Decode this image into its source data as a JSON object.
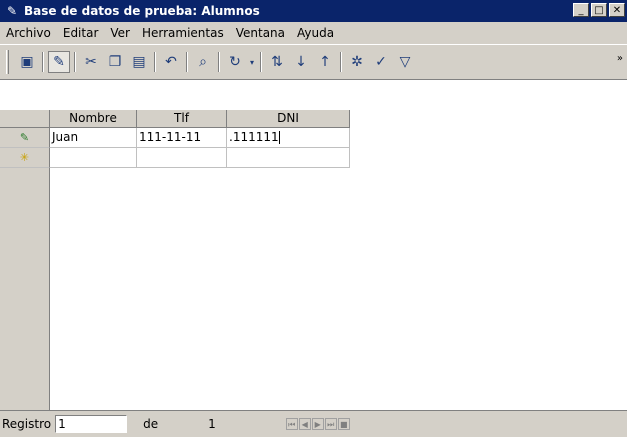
{
  "window": {
    "title": "Base de datos de prueba: Alumnos"
  },
  "menu": [
    "Archivo",
    "Editar",
    "Ver",
    "Herramientas",
    "Ventana",
    "Ayuda"
  ],
  "toolbar": {
    "icons": [
      "save-icon",
      "edit-icon",
      "cut-icon",
      "copy-icon",
      "paste-icon",
      "undo-icon",
      "find-icon",
      "refresh-icon",
      "sort-icon",
      "sort-ascending-icon",
      "sort-descending-icon",
      "filter-auto-icon",
      "filter-apply-icon",
      "filter-icon"
    ]
  },
  "table": {
    "columns": [
      "Nombre",
      "Tlf",
      "DNI"
    ],
    "rows": [
      {
        "nombre": "Juan",
        "tlf": "111-11-11",
        "dni": ".111111"
      },
      {
        "nombre": "",
        "tlf": "",
        "dni": ""
      }
    ]
  },
  "status": {
    "label": "Registro",
    "current": "1",
    "of": "de",
    "total": "1"
  }
}
